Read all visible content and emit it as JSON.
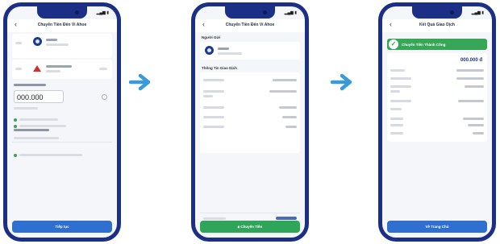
{
  "screens": [
    {
      "status_time": "",
      "status_icons": "▂▄▆ ▮",
      "title": "Chuyển Tiền Đến Ví Ahoe",
      "amount": "000.000",
      "button_label": "Tiếp tục"
    },
    {
      "status_time": "",
      "status_icons": "▂▄▆ ▮",
      "title": "Chuyển Tiền Đến Ví Ahoe",
      "section_recipient": "Người Gửi",
      "section_info": "Thông Tin Giao Dịch",
      "button_label": "Chuyển Tiền",
      "total_label": "Tổng thanh toán"
    },
    {
      "status_time": "",
      "status_icons": "▂▄▆ ▮",
      "title": "Kết Quả Giao Dịch",
      "banner_text": "Chuyển Tiền Thành Công",
      "amount": "000.000 đ",
      "button_label": "Về Trang Chủ"
    }
  ],
  "colors": {
    "phone_frame": "#1b2f86",
    "primary_button": "#2f6fd0",
    "confirm_button": "#2fa55a",
    "success": "#37a657",
    "arrow": "#3a9ad9"
  },
  "icons": [
    "back-arrow-icon",
    "avatar-icon",
    "check-icon",
    "arrow-right-icon"
  ]
}
